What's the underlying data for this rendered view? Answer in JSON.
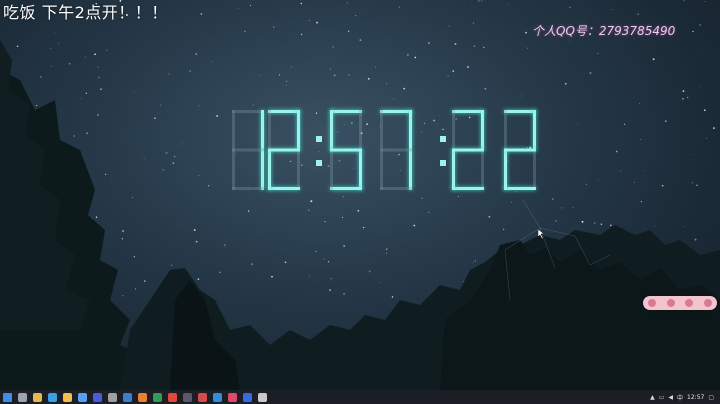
{
  "overlay": {
    "note": "吃饭 下午2点开！！！",
    "qq_label": "个人QQ号：2793785490"
  },
  "clock": {
    "hours": "12",
    "minutes": "57",
    "seconds": "22"
  },
  "colors": {
    "digit_on": "#9ef3e8",
    "digit_glow": "#3fe0d0",
    "digit_off": "#7f9aa6",
    "qq_text": "#f2c8ee",
    "widget": "#f4c4ce",
    "taskbar": "#1b1e24"
  },
  "taskbar": {
    "pinned_icons": [
      {
        "name": "windows-start-icon",
        "color": "#3b8fe8"
      },
      {
        "name": "search-icon",
        "color": "#9aa4ae"
      },
      {
        "name": "folder-icon",
        "color": "#e7b84a"
      },
      {
        "name": "mail-icon",
        "color": "#3aa0e6"
      },
      {
        "name": "folder-icon",
        "color": "#f0c04a"
      },
      {
        "name": "chat-icon",
        "color": "#5aa0f0"
      },
      {
        "name": "app-icon",
        "color": "#4a5ad8"
      },
      {
        "name": "settings-icon",
        "color": "#a0a0a0"
      },
      {
        "name": "code-icon",
        "color": "#3a7fd0"
      },
      {
        "name": "browser-icon",
        "color": "#e8822e"
      },
      {
        "name": "app-icon",
        "color": "#2f9c5a"
      },
      {
        "name": "chrome-icon",
        "color": "#e5473a"
      },
      {
        "name": "app-icon",
        "color": "#5a5a66"
      },
      {
        "name": "app-icon",
        "color": "#d64b4b"
      },
      {
        "name": "app-icon",
        "color": "#2f8fd8"
      },
      {
        "name": "app-icon",
        "color": "#e04a6a"
      },
      {
        "name": "app-icon",
        "color": "#3a6ae0"
      },
      {
        "name": "app-icon",
        "color": "#c9c9c9"
      }
    ],
    "ime": "中",
    "clock_time": "12:57"
  }
}
